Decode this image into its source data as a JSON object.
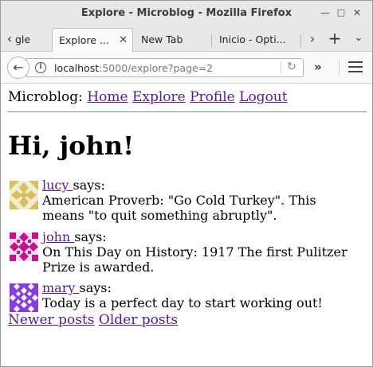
{
  "window": {
    "title": "Explore - Microblog - Mozilla Firefox",
    "controls": [
      "minimize-icon",
      "maximize-icon",
      "close-icon"
    ]
  },
  "tabs": [
    {
      "label": "gle",
      "active": false
    },
    {
      "label": "Explore ...",
      "active": true
    },
    {
      "label": "New Tab",
      "active": false
    },
    {
      "label": "Inicio - Opti...",
      "active": false
    }
  ],
  "navbar": {
    "url_host": "localhost",
    "url_rest": ":5000/explore?page=2"
  },
  "page": {
    "brand": "Microblog:",
    "nav_links": [
      "Home",
      "Explore",
      "Profile",
      "Logout"
    ],
    "greeting": "Hi, john!",
    "says": "says:",
    "posts": [
      {
        "author": "lucy",
        "body": "American Proverb: \"Go Cold Turkey\". This means \"to quit something abruptly\".",
        "avatar_color": "#d8c060"
      },
      {
        "author": "john",
        "body": "On This Day on History: 1917 The first Pulitzer Prize is awarded.",
        "avatar_color": "#c0148c"
      },
      {
        "author": "mary",
        "body": "Today is a perfect day to start working out!",
        "avatar_color": "#8a3be0"
      }
    ],
    "pager": {
      "newer": "Newer posts",
      "older": "Older posts"
    }
  }
}
